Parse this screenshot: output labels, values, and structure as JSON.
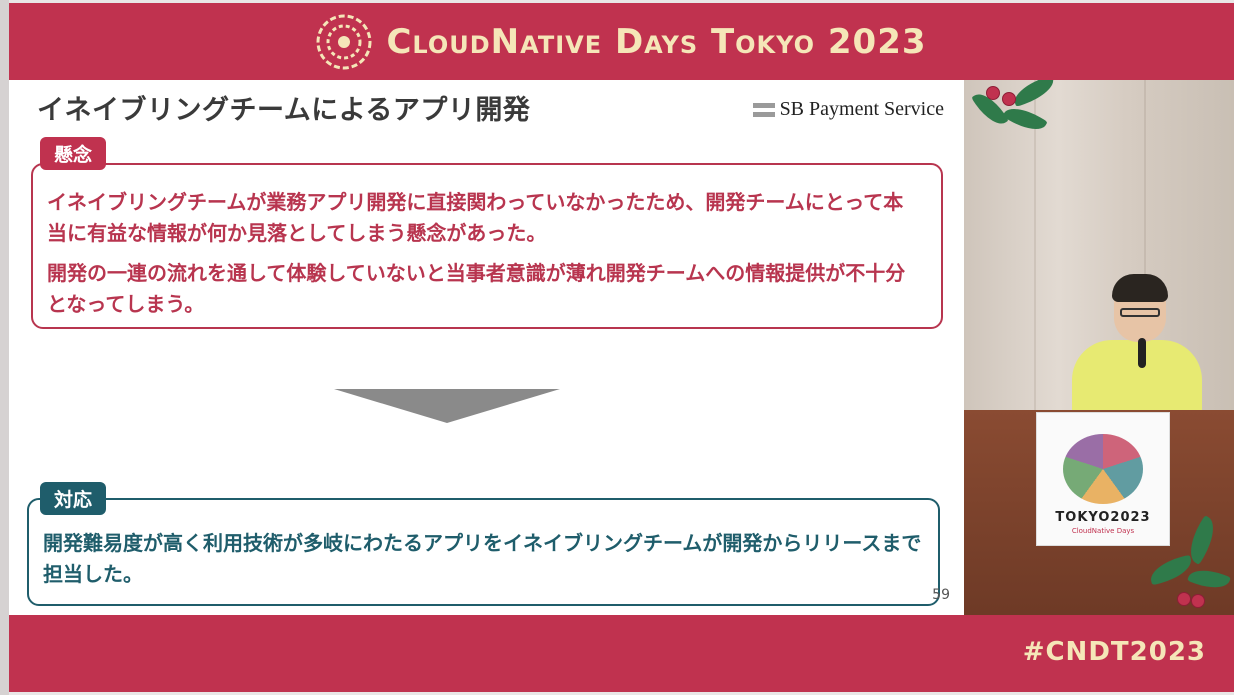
{
  "banner": {
    "title": "CloudNative Days Tokyo 2023",
    "hashtag": "#CNDT2023"
  },
  "slide": {
    "title": "イネイブリングチームによるアプリ開発",
    "company_logo_text": "SB Payment Service",
    "concern": {
      "tag": "懸念",
      "paragraphs": [
        "イネイブリングチームが業務アプリ開発に直接関わっていなかったため、開発チームにとって本当に有益な情報が何か見落としてしまう懸念があった。",
        "開発の一連の流れを通して体験していないと当事者意識が薄れ開発チームへの情報提供が不十分となってしまう。"
      ]
    },
    "response": {
      "tag": "対応",
      "text": "開発難易度が高く利用技術が多岐にわたるアプリをイネイブリングチームが開発からリリースまで担当した。"
    },
    "page_number": "59"
  },
  "camera": {
    "podium_sign_title": "TOKYO2023",
    "podium_sign_sub": "CloudNative Days"
  },
  "colors": {
    "brand": "#c0324f",
    "accent_text": "#f5e6b8",
    "teal": "#1f5d6b"
  }
}
